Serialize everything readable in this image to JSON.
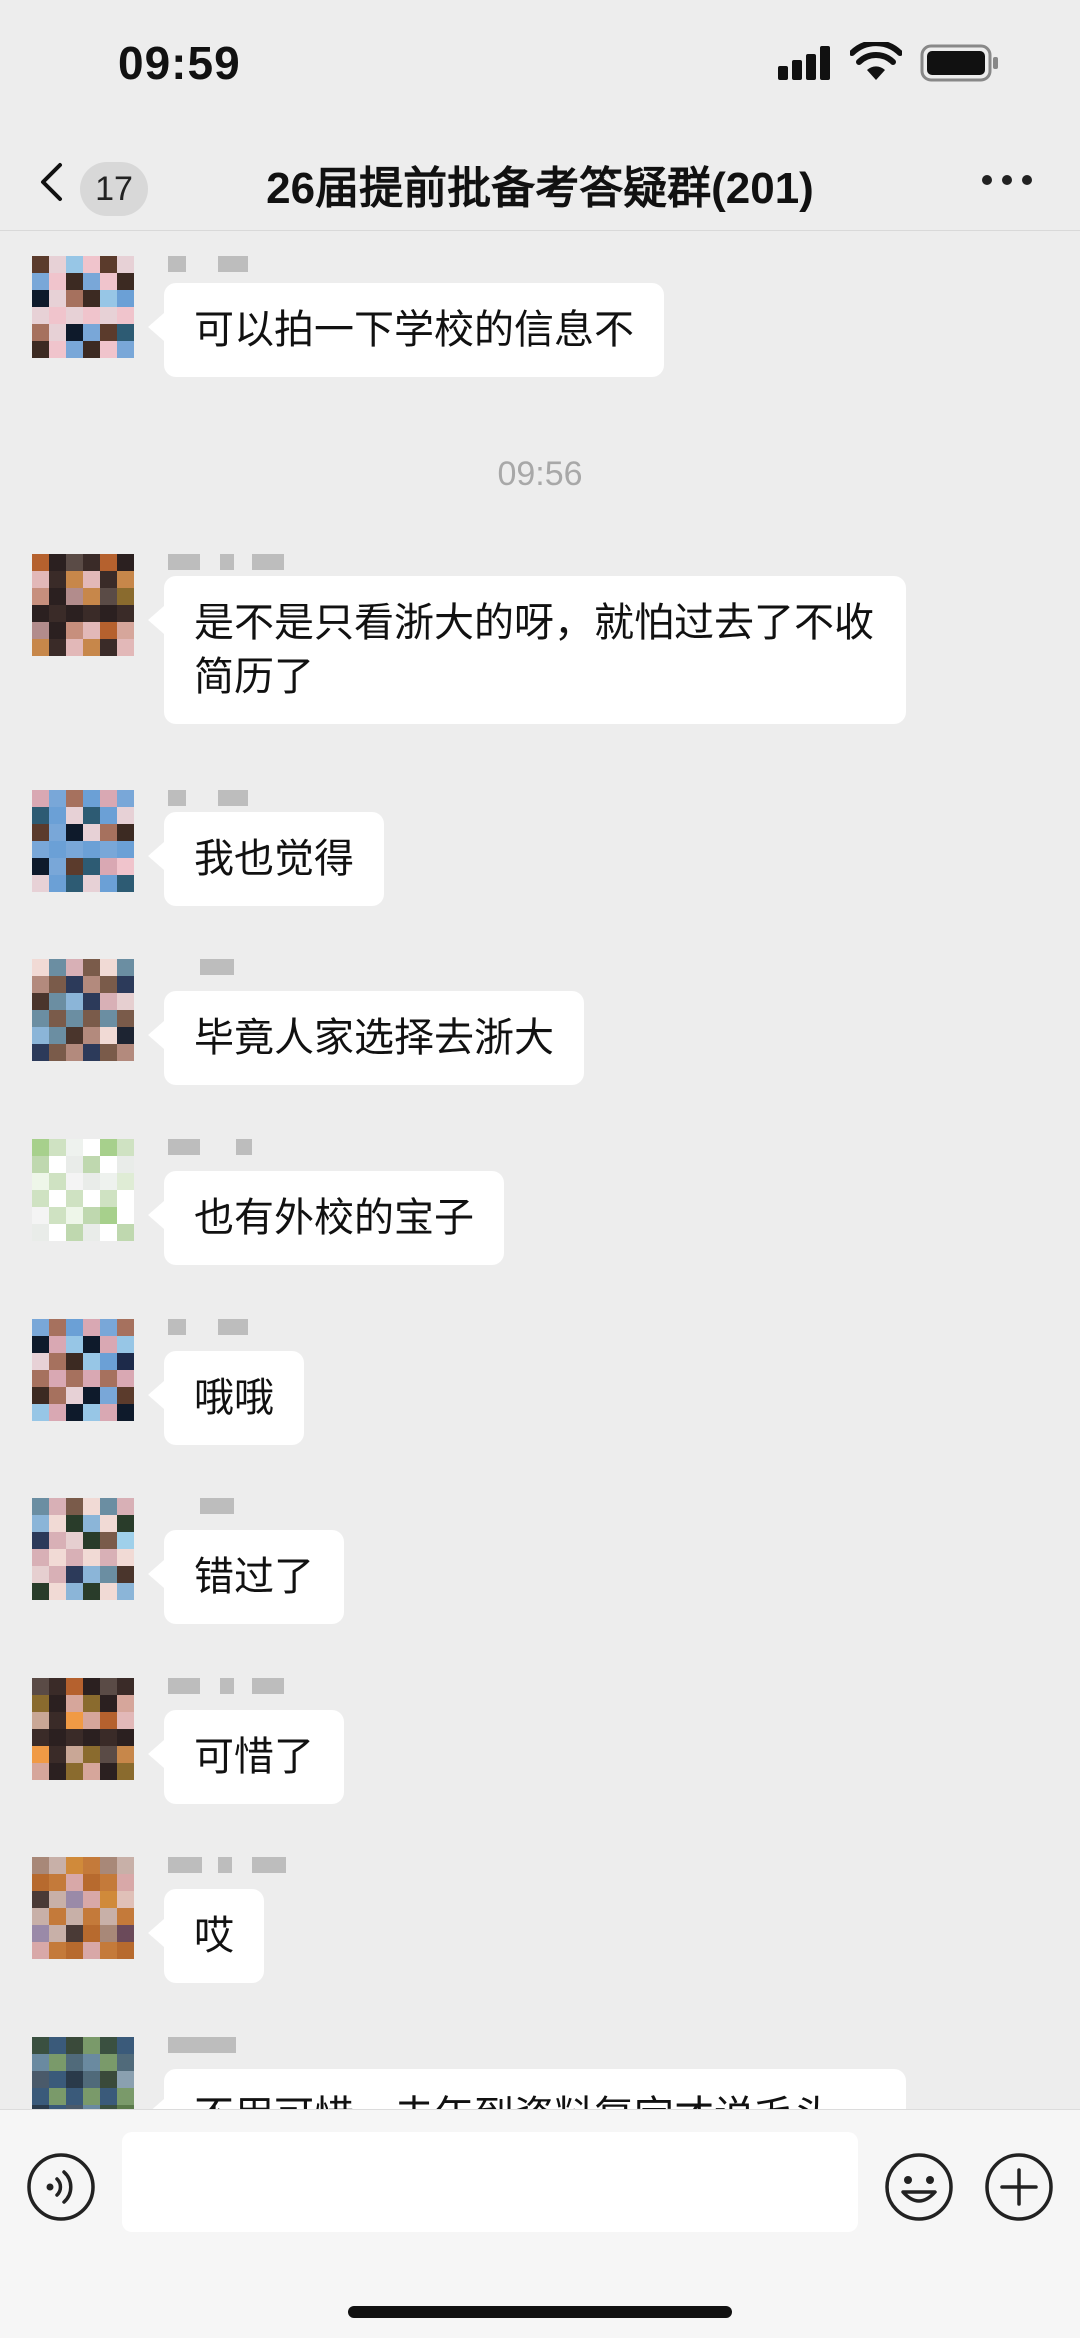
{
  "status_bar": {
    "time": "09:59"
  },
  "header": {
    "unread_count": "17",
    "title": "26届提前批备考答疑群(201)"
  },
  "timestamp": "09:56",
  "messages": [
    {
      "text": "可以拍一下学校的信息不"
    },
    {
      "text": "是不是只看浙大的呀，就怕过去了不收简历了"
    },
    {
      "text": "我也觉得"
    },
    {
      "text": "毕竟人家选择去浙大"
    },
    {
      "text": "也有外校的宝子"
    },
    {
      "text": "哦哦"
    },
    {
      "text": "错过了"
    },
    {
      "text": "可惜了"
    },
    {
      "text": "哎"
    },
    {
      "text": "不用可惜，去年到资料复定才说毛头"
    }
  ],
  "input": {
    "value": ""
  },
  "icons": [
    "signal-icon",
    "wifi-icon",
    "battery-icon",
    "back-chevron-icon",
    "more-icon",
    "voice-icon",
    "emoji-icon",
    "plus-icon"
  ],
  "colors": {
    "background": "#ededed",
    "bubble": "#ffffff",
    "input_bar": "#f6f6f6",
    "timestamp": "#a8a8a8"
  }
}
